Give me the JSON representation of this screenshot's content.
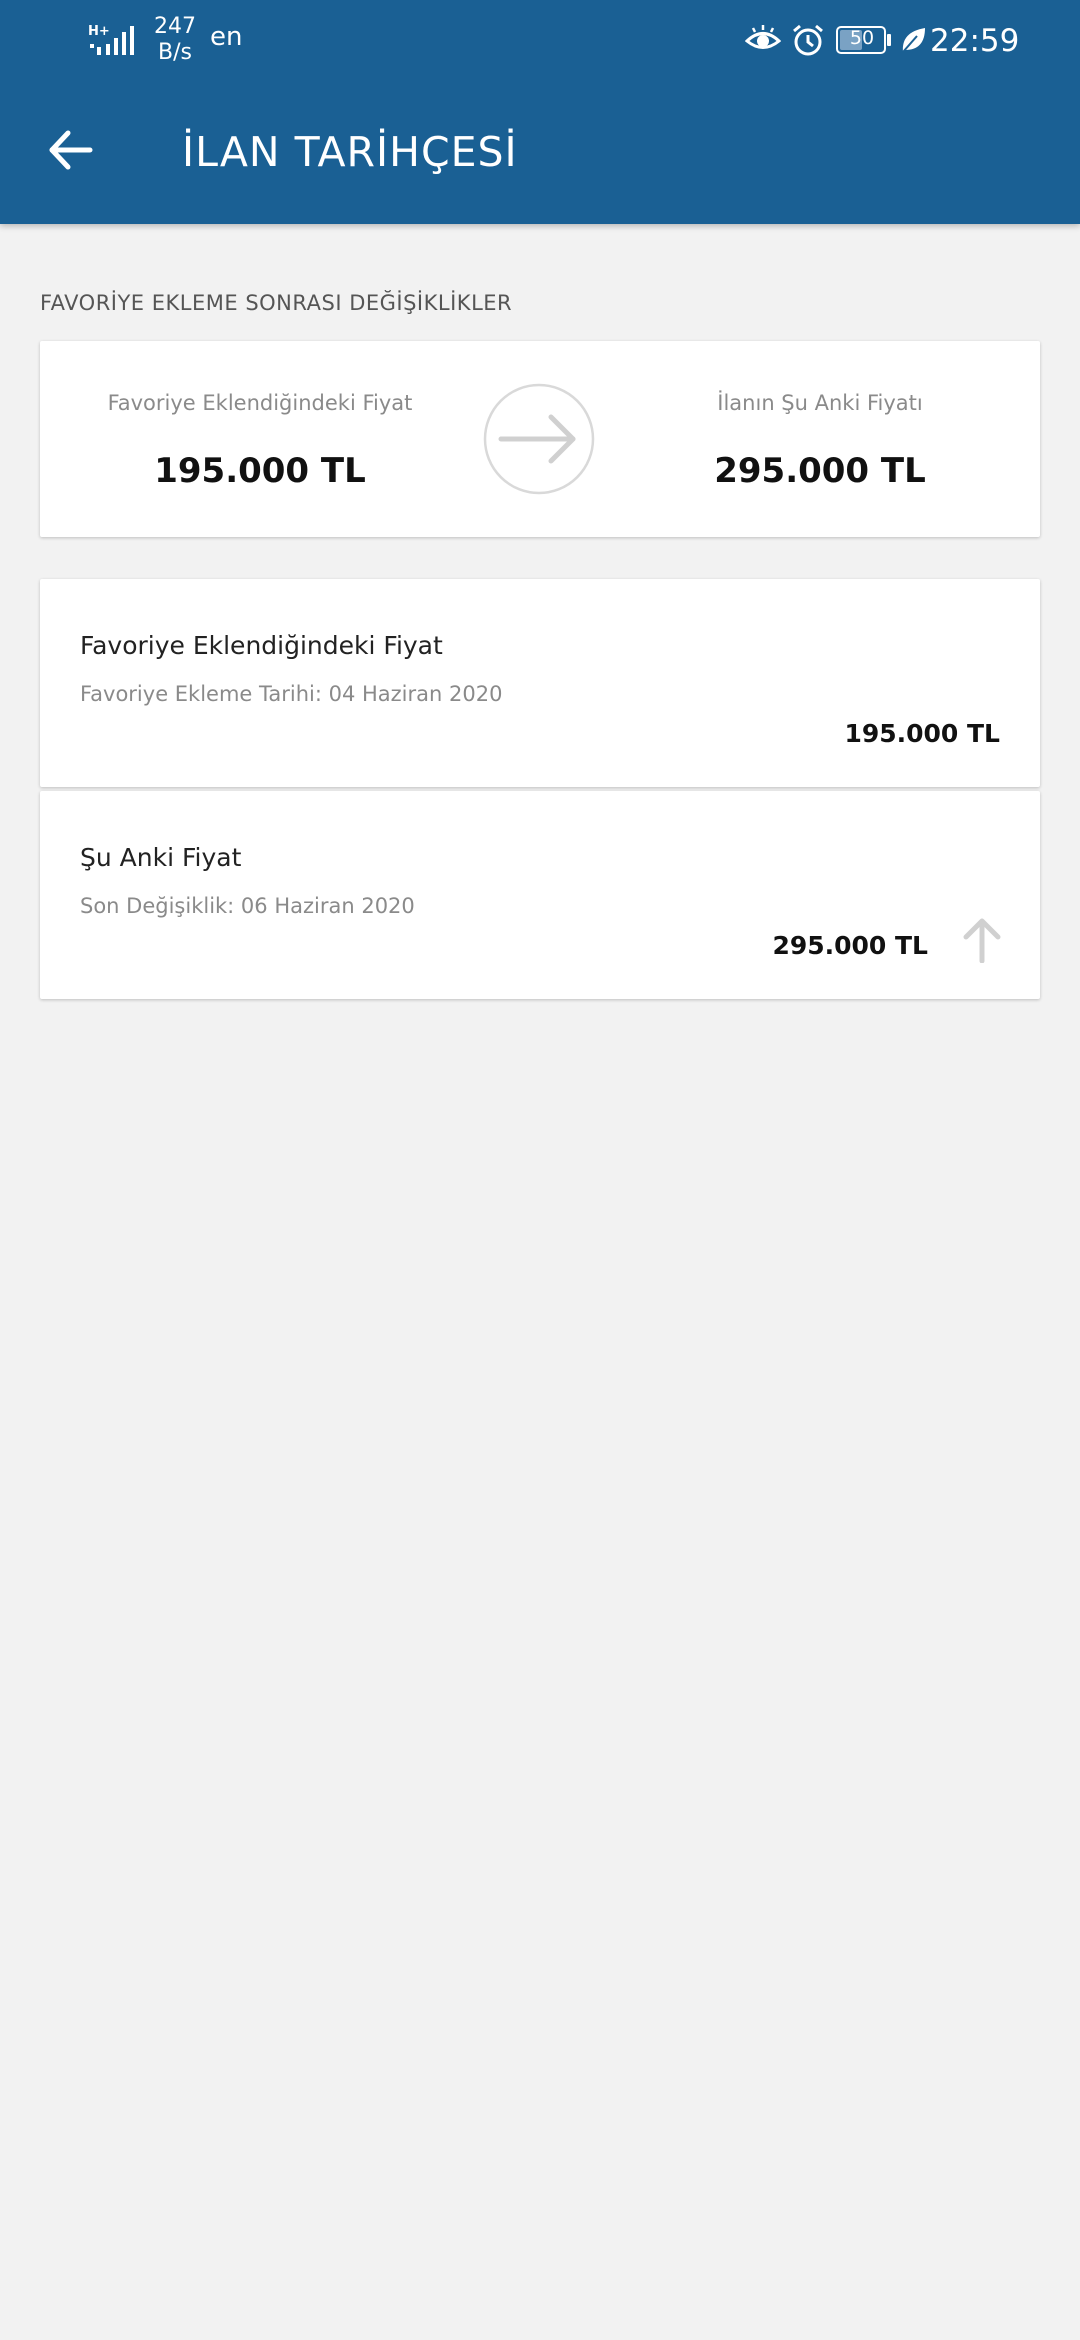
{
  "status_bar": {
    "network_type": "H+",
    "speed_value": "247",
    "speed_unit": "B/s",
    "language": "en",
    "battery": "50",
    "time": "22:59"
  },
  "app_bar": {
    "title": "İLAN TARİHÇESİ"
  },
  "section": {
    "title": "FAVORİYE EKLEME SONRASI DEĞİŞİKLİKLER"
  },
  "summary": {
    "left_label": "Favoriye Eklendiğindeki Fiyat",
    "left_price": "195.000 TL",
    "right_label": "İlanın Şu Anki Fiyatı",
    "right_price": "295.000 TL"
  },
  "history": [
    {
      "title": "Favoriye Eklendiğindeki Fiyat",
      "subtitle": "Favoriye Ekleme Tarihi: 04 Haziran 2020",
      "price": "195.000 TL"
    },
    {
      "title": "Şu Anki Fiyat",
      "subtitle": "Son Değişiklik: 06 Haziran 2020",
      "price": "295.000 TL",
      "trend_icon": "arrow-up-icon"
    }
  ],
  "colors": {
    "primary": "#1a6094",
    "background": "#f2f2f2",
    "muted_text": "#8a8a8a",
    "icon_gray": "#d0d0d0"
  }
}
